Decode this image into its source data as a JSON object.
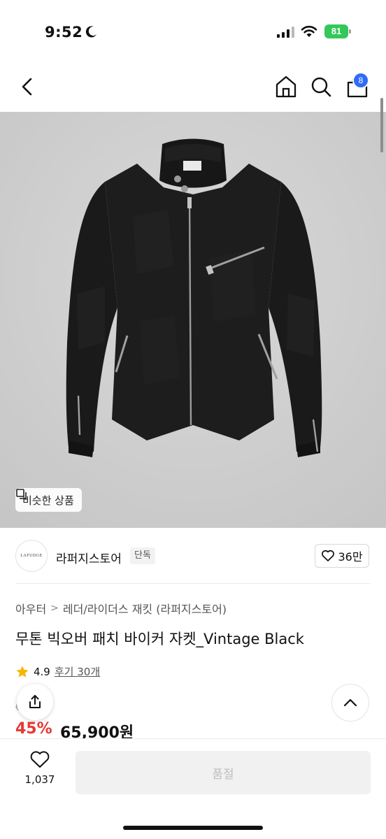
{
  "status_bar": {
    "time": "9:52",
    "battery": "81",
    "icons": [
      "moon-icon",
      "signal-icon",
      "wifi-icon",
      "battery-icon"
    ]
  },
  "nav": {
    "icons": [
      "back-icon",
      "home-icon",
      "search-icon",
      "cart-icon"
    ],
    "cart_count": "8"
  },
  "product_image": {
    "similar_label": "비슷한 상품",
    "logo_text": "LAFUDGE"
  },
  "store": {
    "logo_text": "LAFUDGE",
    "name": "라퍼지스토어",
    "tag": "단독",
    "likes": "36만"
  },
  "breadcrumb": {
    "level1": "아우터",
    "separator": ">",
    "level2": "레더/라이더스 재킷 (라퍼지스토어)"
  },
  "product": {
    "title": "무톤 빅오버 패치 바이커 자켓_Vintage Black",
    "rating": "4.9",
    "review_link": "후기 30개",
    "original_price": "0원",
    "discount": "45%",
    "price": "65,900원"
  },
  "bottom": {
    "wish_count": "1,037",
    "cta": "품절"
  },
  "colors": {
    "accent_blue": "#2f6cf6",
    "discount_red": "#e53935",
    "star": "#f7b500",
    "battery_green": "#34c759"
  }
}
